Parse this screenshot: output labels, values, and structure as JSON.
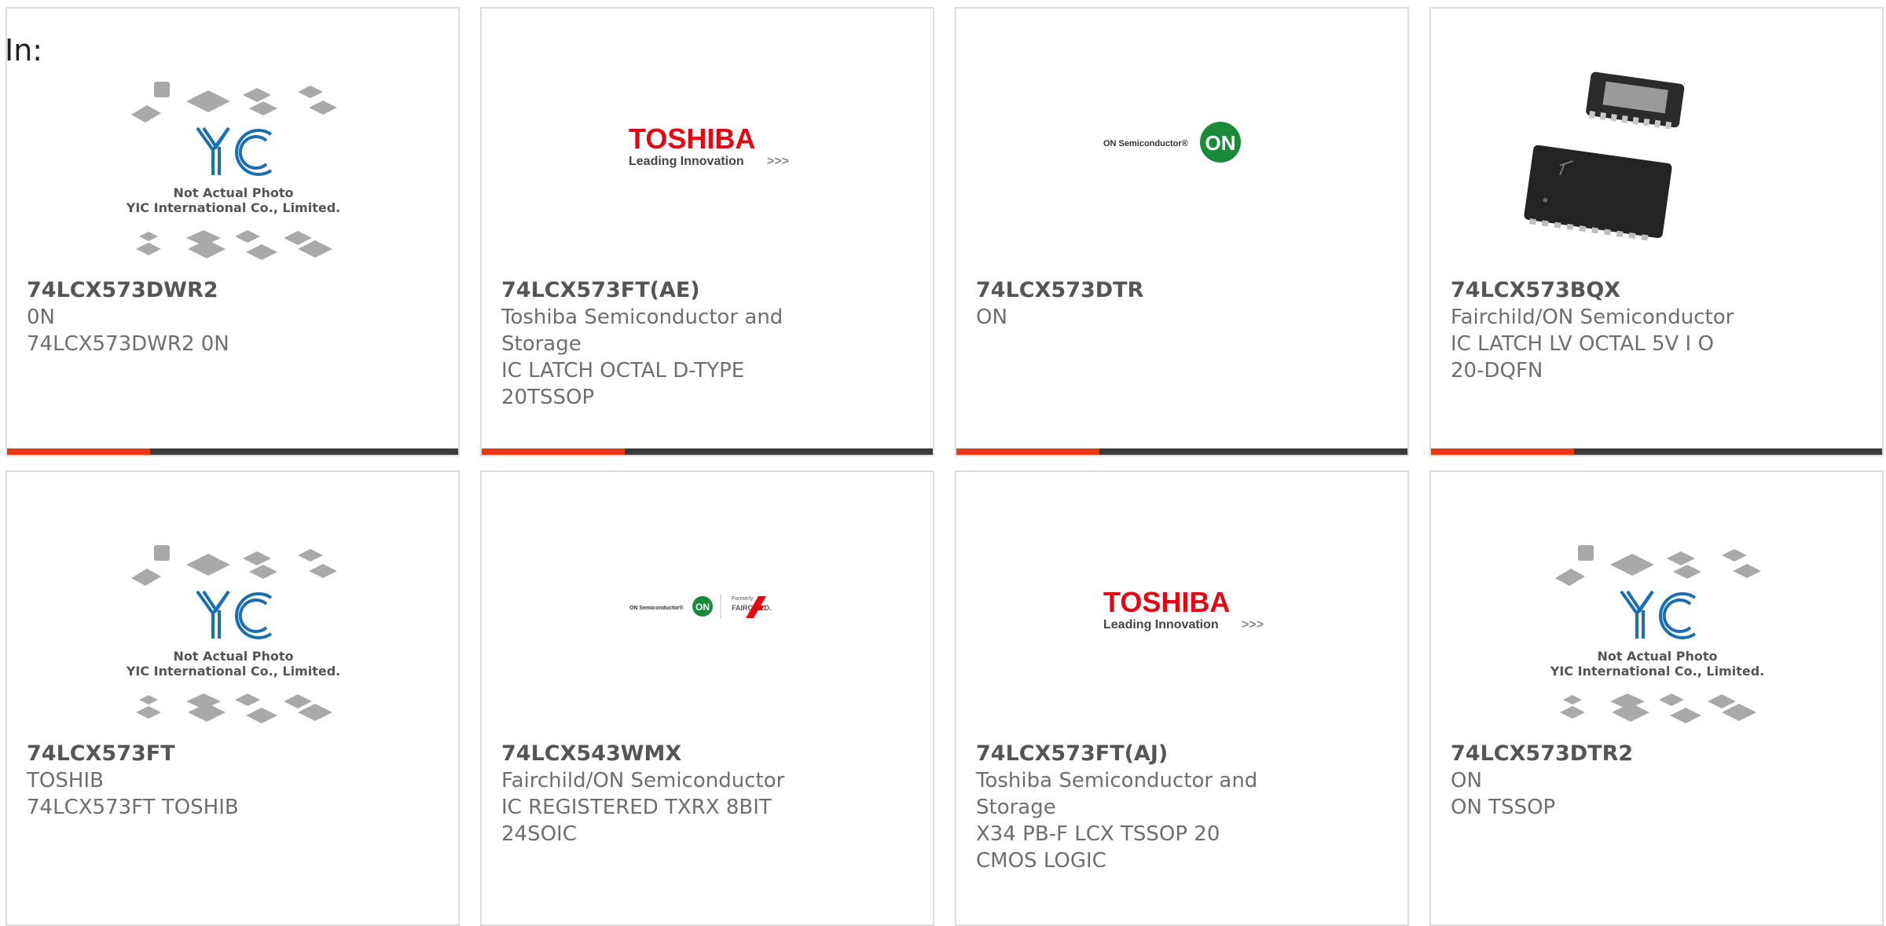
{
  "header": {
    "in_label": "In:"
  },
  "colors": {
    "accent": "#e8390e",
    "bar_dark": "#3a3a3a",
    "toshiba_red": "#e30613",
    "on_green": "#1a8a3a",
    "yic_blue": "#1a6fb3"
  },
  "placeholder": {
    "line1": "Not Actual Photo",
    "line2": "YIC International Co., Limited.",
    "logo_text": "YIC"
  },
  "brand_logos": {
    "toshiba_name": "TOSHIBA",
    "toshiba_tagline": "Leading Innovation",
    "toshiba_arrows": ">>>",
    "on_semi_text": "ON Semiconductor®",
    "on_mark": "ON",
    "formerly_text": "Formerly",
    "fairchild_text": "FAIRCHILD."
  },
  "products": [
    {
      "part": "74LCX573DWR2",
      "mfr": "0N",
      "desc": "74LCX573DWR2 0N",
      "image": "placeholder"
    },
    {
      "part": "74LCX573FT(AE)",
      "mfr": "Toshiba Semiconductor and Storage",
      "desc": "IC LATCH OCTAL D-TYPE 20TSSOP",
      "image": "toshiba-logo"
    },
    {
      "part": "74LCX573DTR",
      "mfr": "ON",
      "desc": "",
      "image": "on-semi-logo"
    },
    {
      "part": "74LCX573BQX",
      "mfr": "Fairchild/ON Semiconductor",
      "desc": "IC LATCH LV OCTAL 5V I O 20-DQFN",
      "image": "chip-photo"
    },
    {
      "part": "74LCX573FT",
      "mfr": "TOSHIB",
      "desc": "74LCX573FT TOSHIB",
      "image": "placeholder"
    },
    {
      "part": "74LCX543WMX",
      "mfr": "Fairchild/ON Semiconductor",
      "desc": "IC REGISTERED TXRX 8BIT 24SOIC",
      "image": "fairchild-on-logo"
    },
    {
      "part": "74LCX573FT(AJ)",
      "mfr": "Toshiba Semiconductor and Storage",
      "desc": "X34 PB-F LCX TSSOP 20 CMOS LOGIC",
      "image": "toshiba-logo"
    },
    {
      "part": "74LCX573DTR2",
      "mfr": "ON",
      "desc": "ON TSSOP",
      "image": "placeholder"
    }
  ]
}
